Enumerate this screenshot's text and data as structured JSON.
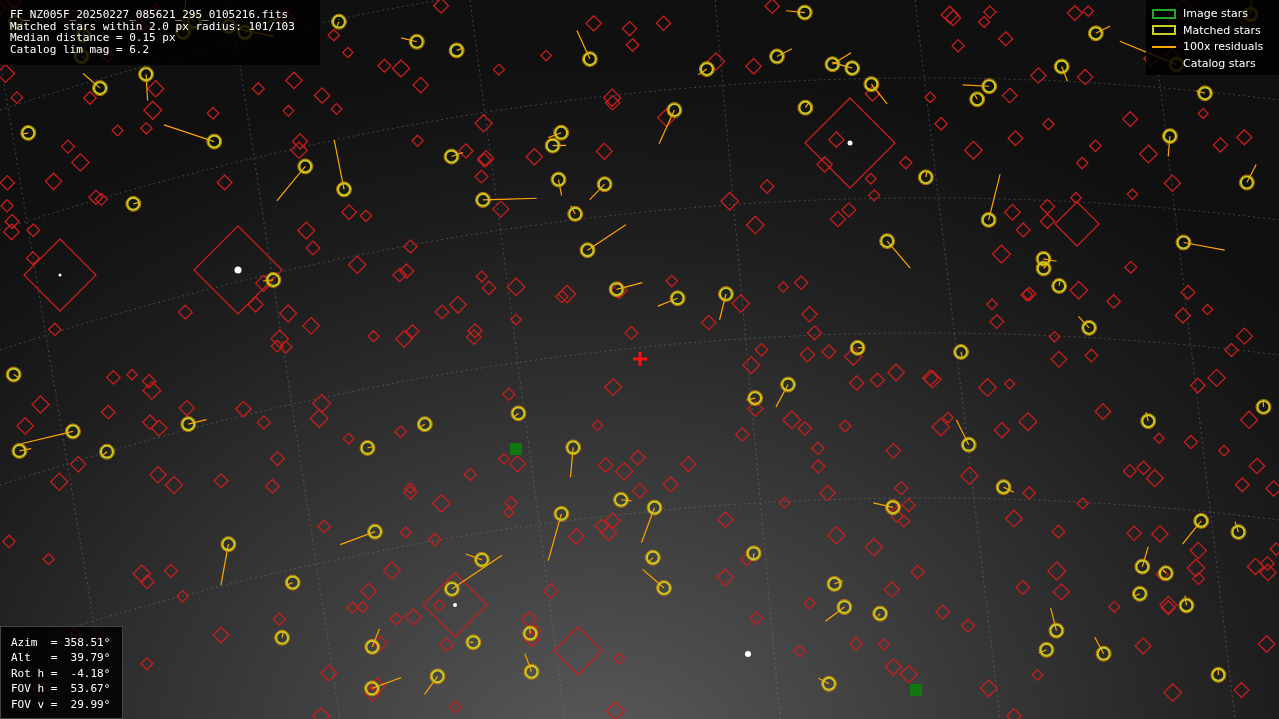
{
  "info_lines": [
    "FF_NZ005F_20250227_085621_295_0105216.fits",
    "Matched stars within 2.0 px radius: 101/103",
    "Median distance = 0.15 px",
    "Catalog lim mag = 6.2"
  ],
  "legend": [
    {
      "kind": "box",
      "color": "#22aa22",
      "label": "Image stars"
    },
    {
      "kind": "box",
      "color": "#cccc22",
      "label": "Matched stars"
    },
    {
      "kind": "line",
      "color": "#ffa500",
      "label": "100x residuals"
    },
    {
      "kind": "none",
      "label": "Catalog stars"
    }
  ],
  "pointing": [
    "Azim  = 358.51°",
    "Alt   =  39.79°",
    "Rot h =  -4.18°",
    "FOV h =  53.67°",
    "FOV v =  29.99°"
  ]
}
